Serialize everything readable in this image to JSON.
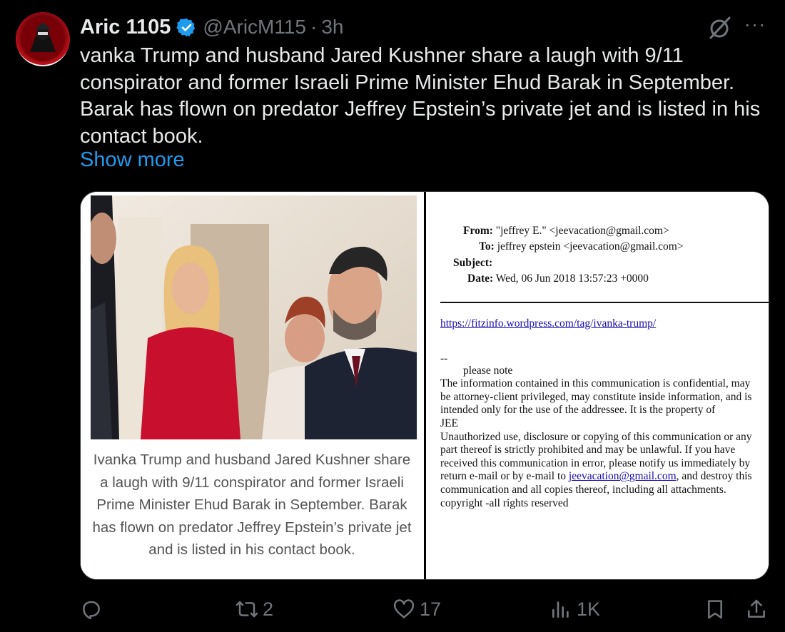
{
  "author": {
    "name": "Aric 1105",
    "handle": "@AricM115",
    "separator": "·",
    "time": "3h"
  },
  "tweet": {
    "text": "vanka Trump and husband Jared Kushner share a laugh with 9/11 conspirator and former Israeli Prime Minister Ehud Barak in September. Barak has flown on predator Jeffrey Epstein’s private jet and is listed in his contact book.",
    "show_more": "Show more"
  },
  "media": {
    "left": {
      "caption": "Ivanka Trump and husband Jared Kushner share a laugh with 9/11 conspirator and former Israeli Prime Minister Ehud Barak in September. Barak has flown on predator Jeffrey Epstein’s private jet and is listed in his contact book."
    },
    "right": {
      "from_label": "From:",
      "from_value": "\"jeffrey E.\" <jeevacation@gmail.com>",
      "to_label": "To:",
      "to_value": "jeffrey epstein <jeevacation@gmail.com>",
      "subject_label": "Subject:",
      "date_label": "Date:",
      "date_value": "Wed, 06 Jun 2018 13:57:23 +0000",
      "link": "https://fitzinfo.wordpress.com/tag/ivanka-trump/",
      "sig_dash": "--",
      "please_note": "please note",
      "para1": "The information contained in this communication is confidential, may be attorney-client privileged, may constitute inside information, and is intended only for the use of the addressee. It is the property of",
      "jee": "JEE",
      "para2_a": "Unauthorized use, disclosure or copying of this communication or any part thereof is strictly prohibited and may be unlawful. If you have received this communication in error, please notify us immediately by return e-mail or by e-mail to",
      "para2_link": "jeevacation@gmail.com",
      "para2_b": ", and destroy this communication and all copies thereof, including all attachments. copyright -all rights reserved"
    }
  },
  "actions": {
    "reply": "",
    "retweet": "2",
    "like": "17",
    "views": "1K"
  },
  "icons": {
    "verified": "verified-badge-icon",
    "grok": "grok-icon",
    "more": "more-icon",
    "reply": "reply-icon",
    "retweet": "retweet-icon",
    "like": "like-icon",
    "views": "views-icon",
    "bookmark": "bookmark-icon",
    "share": "share-icon"
  },
  "colors": {
    "link_blue": "#1d9bf0",
    "muted": "#71767b",
    "text": "#e7e9ea",
    "background": "#000000"
  }
}
